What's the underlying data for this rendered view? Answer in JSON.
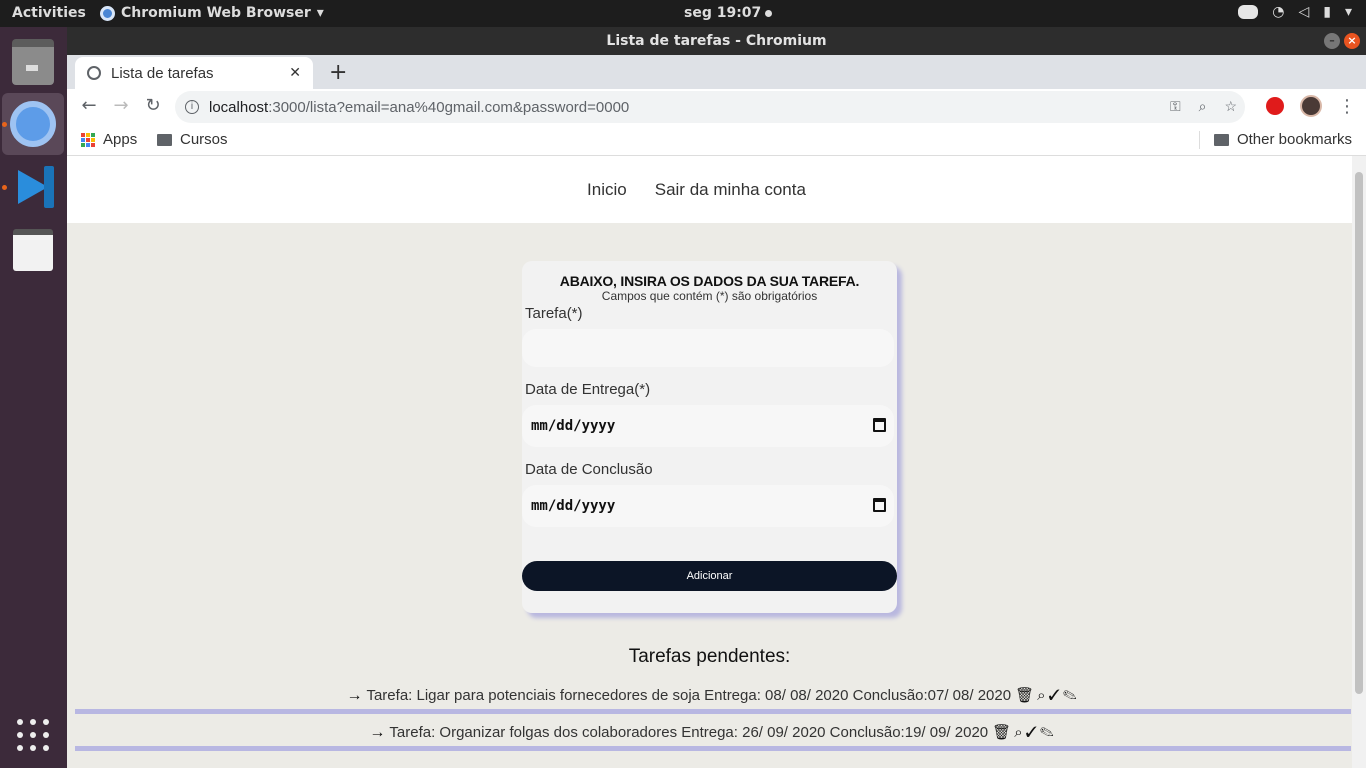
{
  "desktop": {
    "activities": "Activities",
    "app_menu": "Chromium Web Browser",
    "clock": "seg 19:07",
    "dock_items": [
      "files-icon",
      "chromium-icon",
      "vscode-icon",
      "text-editor-icon",
      "show-apps-icon"
    ]
  },
  "window": {
    "title": "Lista de tarefas - Chromium",
    "tab_title": "Lista de tarefas",
    "url_host": "localhost",
    "url_rest": ":3000/lista?email=ana%40gmail.com&password=0000",
    "bookmarks": [
      "Apps",
      "Cursos"
    ],
    "other_bookmarks": "Other bookmarks"
  },
  "page": {
    "nav": {
      "home": "Inicio",
      "logout": "Sair da minha conta"
    },
    "form": {
      "heading": "ABAIXO, INSIRA OS DADOS DA SUA TAREFA.",
      "subheading": "Campos que contém (*) são obrigatórios",
      "task_label": "Tarefa(*)",
      "task_value": "",
      "due_label": "Data de Entrega(*)",
      "due_placeholder": "mm/dd/yyyy",
      "done_label": "Data de Conclusão",
      "done_placeholder": "mm/dd/yyyy",
      "submit": "Adicionar"
    },
    "pending_title": "Tarefas pendentes:",
    "tasks": [
      {
        "text": "Tarefa: Ligar para potenciais fornecedores de soja Entrega: 08/ 08/ 2020 Conclusão:07/ 08/ 2020"
      },
      {
        "text": "Tarefa: Organizar folgas dos colaboradores Entrega: 26/ 09/ 2020 Conclusão:19/ 09/ 2020"
      }
    ]
  },
  "colors": {
    "page_bg": "#ecebe6",
    "button_bg": "#0c1526",
    "card_shadow": "#b9b8df",
    "dock_bg": "#3c2a3a"
  }
}
